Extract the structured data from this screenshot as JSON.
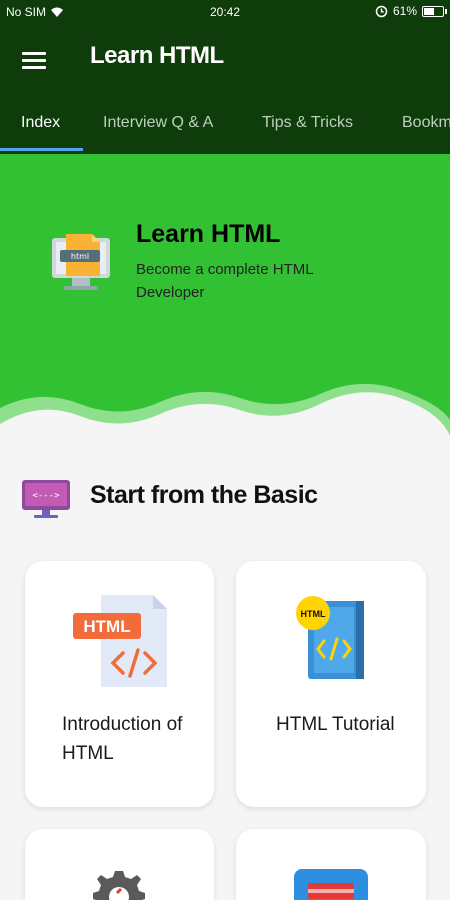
{
  "status": {
    "carrier": "No SIM",
    "time": "20:42",
    "battery": "61%",
    "battery_level": 0.61
  },
  "app": {
    "title": "Learn HTML"
  },
  "tabs": [
    {
      "label": "Index"
    },
    {
      "label": "Interview Q & A"
    },
    {
      "label": "Tips & Tricks"
    },
    {
      "label": "Bookm"
    }
  ],
  "hero": {
    "title": "Learn HTML",
    "subtitle": "Become a complete HTML Developer",
    "icon_text": "html"
  },
  "section": {
    "title": "Start from the Basic",
    "icon_text": "<--->"
  },
  "cards": [
    {
      "label": "Introduction of HTML",
      "badge": "HTML"
    },
    {
      "label": "HTML Tutorial",
      "badge": "HTML"
    },
    {
      "label": ""
    },
    {
      "label": ""
    }
  ],
  "colors": {
    "app_bar": "#0e3d0b",
    "hero": "#33c134",
    "accent": "#4da6f0"
  }
}
